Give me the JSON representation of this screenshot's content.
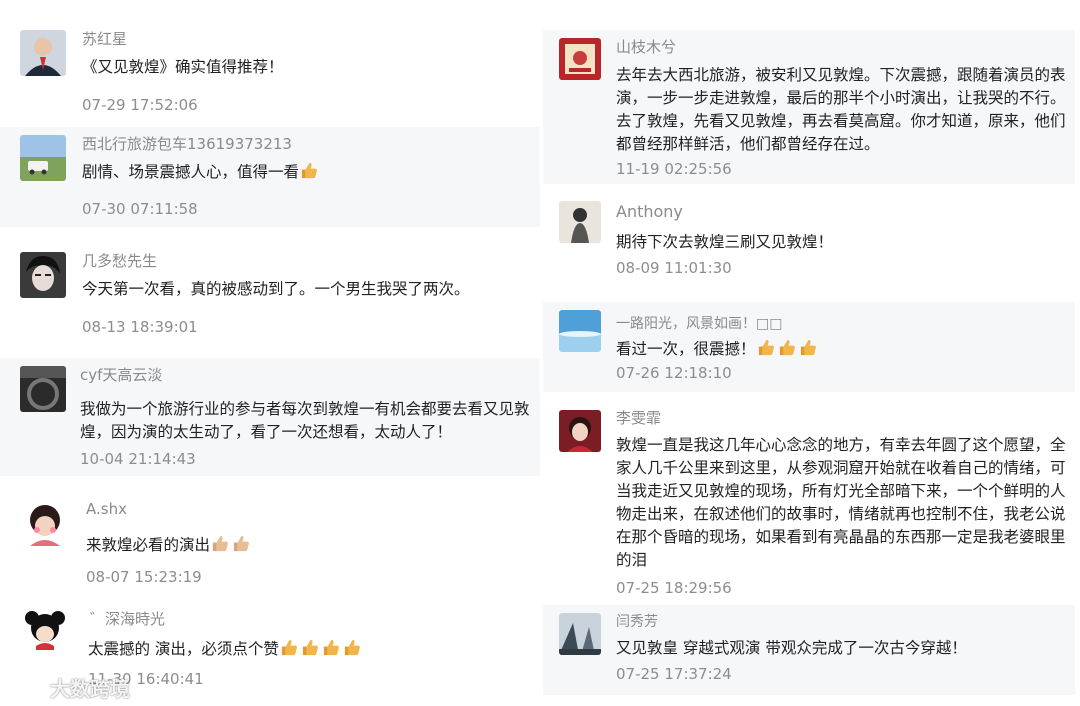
{
  "left_comments": [
    {
      "name": "苏红星",
      "text": "《又见敦煌》确实值得推荐！",
      "time": "07-29 17:52:06",
      "thumbs": 0
    },
    {
      "name": "西北行旅游包车13619373213",
      "text": "剧情、场景震撼人心，值得一看",
      "time": "07-30 07:11:58",
      "thumbs": 1
    },
    {
      "name": "几多愁先生",
      "text": "今天第一次看，真的被感动到了。一个男生我哭了两次。",
      "time": "08-13 18:39:01",
      "thumbs": 0
    },
    {
      "name": "cyf天高云淡",
      "lines": [
        "我做为一个旅游行业的参与者每次到敦煌一有机会都要去看又见敦",
        "煌，因为演的太生动了，看了一次还想看，太动人了！"
      ],
      "time": "10-04 21:14:43",
      "thumbs": 0
    },
    {
      "name": "A.shx",
      "text": "来敦煌必看的演出",
      "time": "08-07 15:23:19",
      "thumbs": 2
    },
    {
      "name": "゛深海時光",
      "text": "太震撼的 演出，必须点个赞",
      "time": "11-30 16:40:41",
      "thumbs": 4
    }
  ],
  "right_comments": [
    {
      "name": "山枝木兮",
      "lines": [
        "去年去大西北旅游，被安利又见敦煌。下次震撼，跟随着演员的表",
        "演，一步一步走进敦煌，最后的那半个小时演出，让我哭的不行。",
        "去了敦煌，先看又见敦煌，再去看莫高窟。你才知道，原来，他们",
        "都曾经那样鲜活，他们都曾经存在过。"
      ],
      "time": "11-19 02:25:56",
      "thumbs": 0
    },
    {
      "name": "Anthony",
      "text": "期待下次去敦煌三刷又见敦煌！",
      "time": "08-09 11:01:30",
      "thumbs": 0
    },
    {
      "name": "一路阳光，风景如画！□□",
      "text": "看过一次，很震撼！",
      "time": "07-26 12:18:10",
      "thumbs": 3
    },
    {
      "name": "李雯霏",
      "lines": [
        "敦煌一直是我这几年心心念念的地方，有幸去年圆了这个愿望，全",
        "家人几千公里来到这里，从参观洞窟开始就在收着自己的情绪，可",
        "当我走近又见敦煌的现场，所有灯光全部暗下来，一个个鲜明的人",
        "物走出来，在叙述他们的故事时，情绪就再也控制不住，我老公说",
        "在那个昏暗的现场，如果看到有亮晶晶的东西那一定是我老婆眼里",
        "的泪"
      ],
      "time": "07-25 18:29:56",
      "thumbs": 0
    },
    {
      "name": "闫秀芳",
      "text": "又见敦皇 穿越式观演 带观众完成了一次古今穿越！",
      "time": "07-25 17:37:24",
      "thumbs": 0
    }
  ],
  "watermark": "大数跨境",
  "colors": {
    "card_bg": "#f6f7f9",
    "name": "#8a8a8a",
    "time": "#8d8d8d",
    "text": "#222222",
    "thumb": "#f2b54a"
  }
}
